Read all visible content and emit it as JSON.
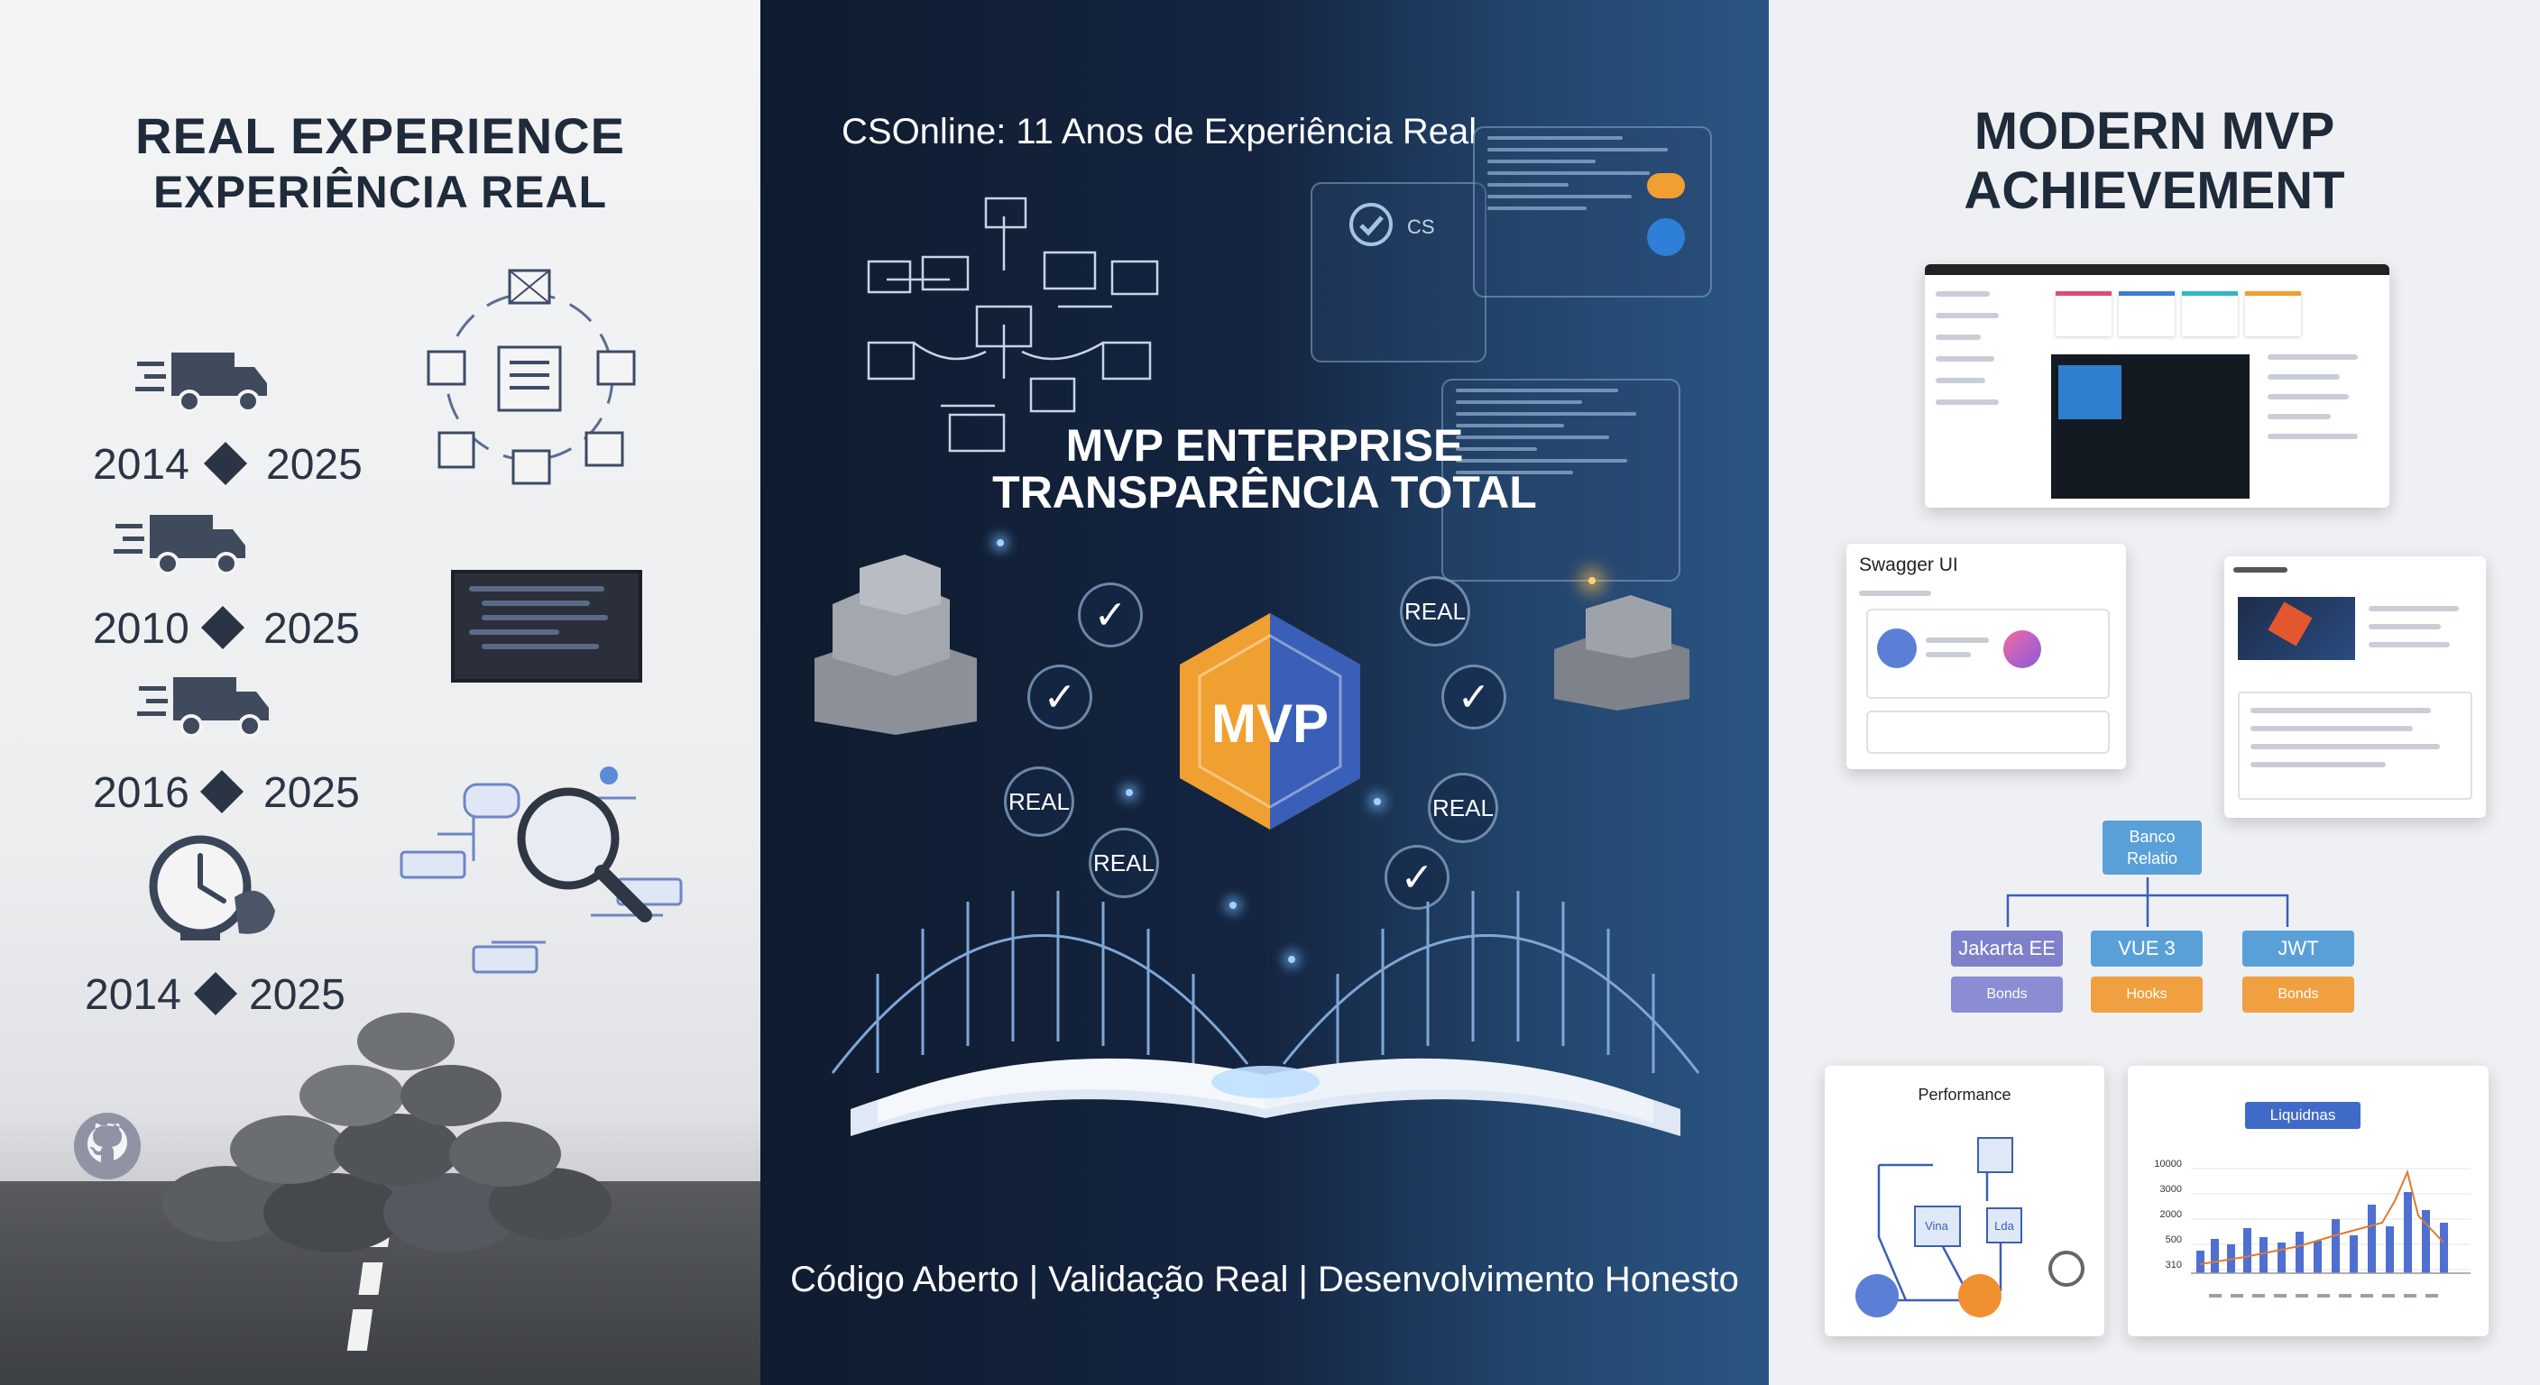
{
  "left_panel": {
    "title_line1": "REAL EXPERIENCE",
    "title_line2": "EXPERIÊNCIA REAL",
    "timeline": [
      {
        "start": "2014",
        "end": "2025"
      },
      {
        "start": "2010",
        "end": "2025"
      },
      {
        "start": "2016",
        "end": "2025"
      },
      {
        "start": "2014",
        "end": "2025"
      }
    ]
  },
  "center_panel": {
    "header": "CSOnline: 11 Anos de Experiência Real",
    "headline_line1": "MVP ENTERPRISE",
    "headline_line2": "TRANSPARÊNCIA TOTAL",
    "badge": "MVP",
    "labels": {
      "real_1": "REAL",
      "real_2": "REAL",
      "real_3": "REAL",
      "real_4": "REAL"
    },
    "card_text": "CS",
    "footer": "Código Aberto | Validação Real | Desenvolvimento Honesto"
  },
  "right_panel": {
    "title_line1": "MODERN MVP",
    "title_line2": "ACHIEVEMENT",
    "swagger_title": "Swagger UI",
    "diagram": {
      "root": "Banco Relatio",
      "nodes": [
        {
          "label": "Jakarta EE",
          "sub": "Bonds",
          "color": "#7e80c9"
        },
        {
          "label": "VUE 3",
          "sub": "Hooks",
          "color": "#5aa0d8"
        },
        {
          "label": "JWT",
          "sub": "Bonds",
          "color": "#5aa0d8"
        }
      ],
      "sub_colors": [
        "#8a8cd4",
        "#f0a040",
        "#f0a040"
      ]
    },
    "performance_title": "Performance",
    "perf_nodes": {
      "center": "Vina",
      "right": "Lda"
    },
    "chart_title": "Liquidnas",
    "chart_yticks": [
      "10000",
      "3000",
      "2000",
      "500",
      "310"
    ]
  },
  "colors": {
    "accent_orange": "#f0a030",
    "accent_blue": "#3f6ac8",
    "dark_navy": "#0f1b2e"
  }
}
